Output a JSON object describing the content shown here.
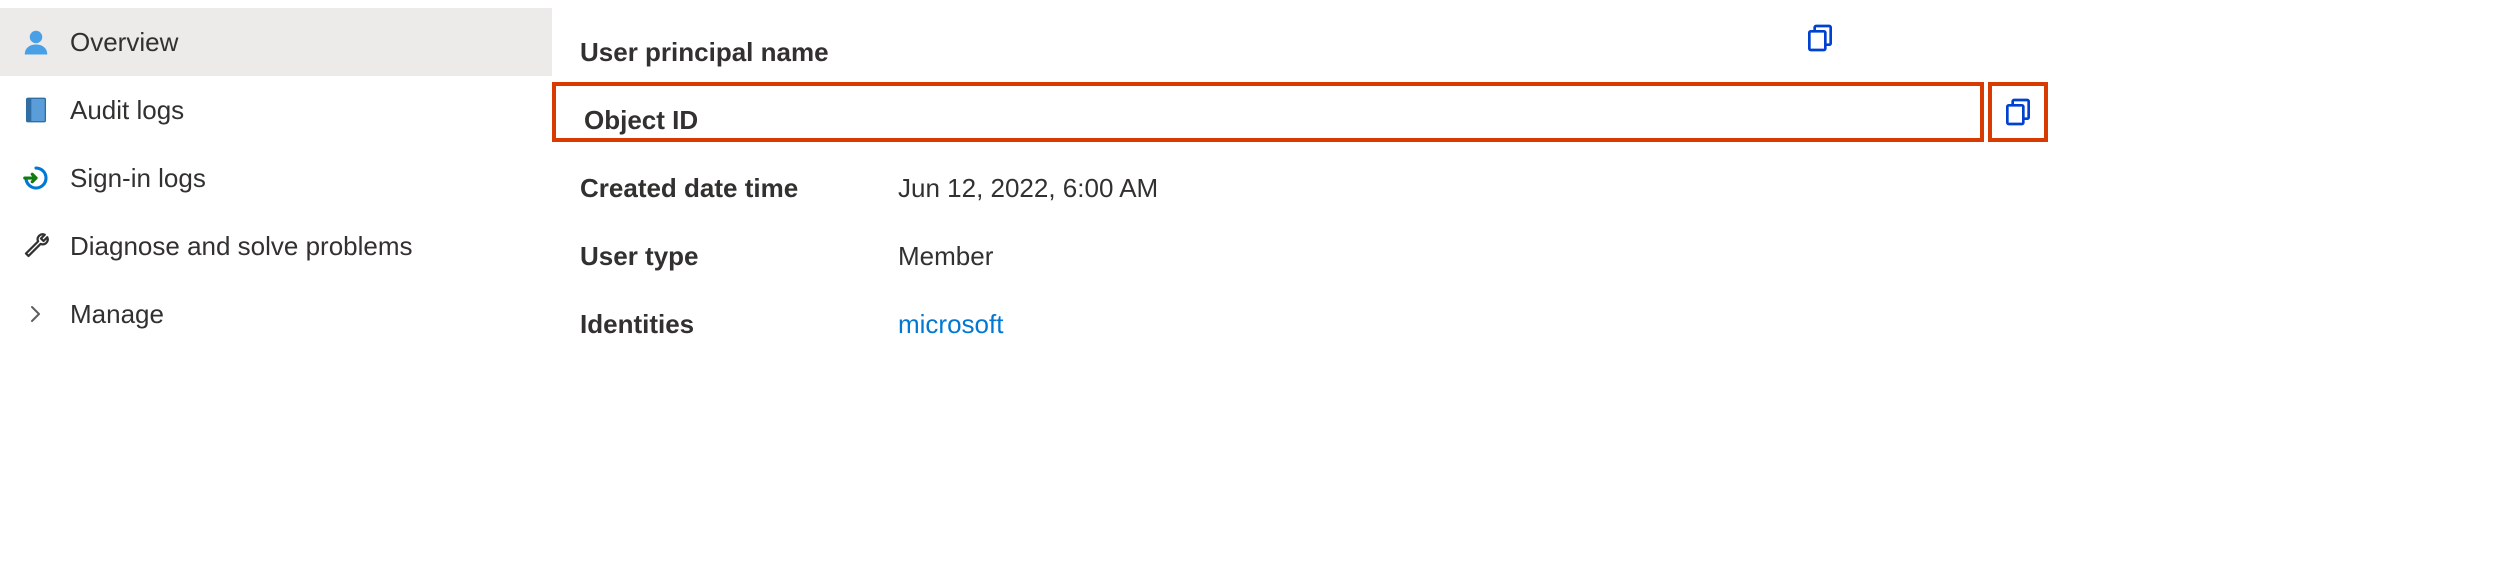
{
  "sidebar": {
    "items": [
      {
        "label": "Overview"
      },
      {
        "label": "Audit logs"
      },
      {
        "label": "Sign-in logs"
      },
      {
        "label": "Diagnose and solve problems"
      },
      {
        "label": "Manage"
      }
    ]
  },
  "details": {
    "upn": {
      "label": "User principal name",
      "value": ""
    },
    "object_id": {
      "label": "Object ID",
      "value": ""
    },
    "created": {
      "label": "Created date time",
      "value": "Jun 12, 2022, 6:00 AM"
    },
    "user_type": {
      "label": "User type",
      "value": "Member"
    },
    "identities": {
      "label": "Identities",
      "value": "microsoft"
    }
  }
}
